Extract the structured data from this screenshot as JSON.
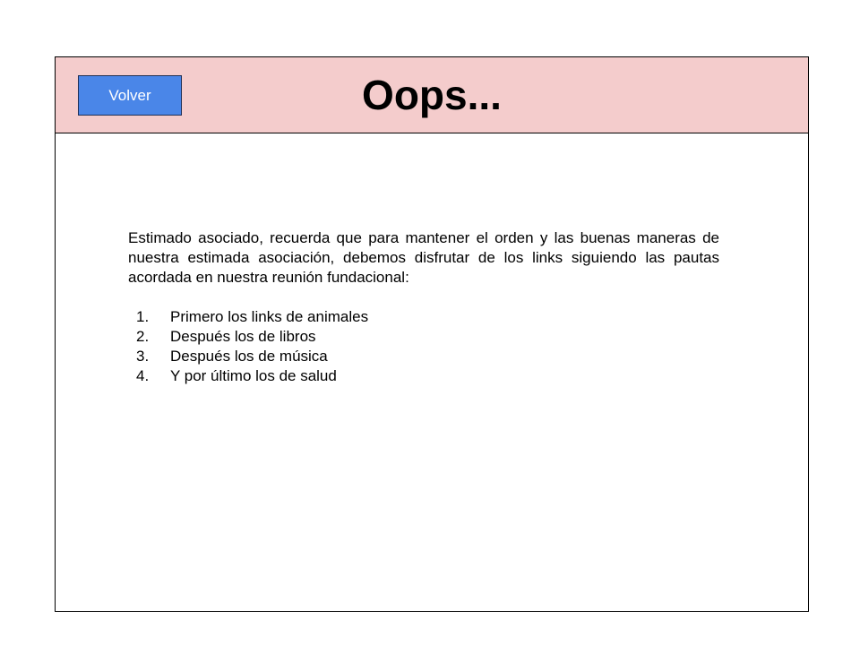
{
  "header": {
    "back_button_label": "Volver",
    "title": "Oops..."
  },
  "content": {
    "intro": "Estimado asociado, recuerda que para mantener el orden y las buenas maneras de nuestra estimada asociación, debemos disfrutar de los links siguiendo las pautas acordada en nuestra reunión fundacional:",
    "rules": [
      {
        "number": "1.",
        "text": "Primero los links de animales"
      },
      {
        "number": "2.",
        "text": "Después los de libros"
      },
      {
        "number": "3.",
        "text": "Después los de música"
      },
      {
        "number": "4.",
        "text": "Y por último los de salud"
      }
    ]
  },
  "colors": {
    "header_background": "#f4cccc",
    "button_background": "#4a86e8",
    "button_text": "#ffffff",
    "border": "#000000"
  }
}
